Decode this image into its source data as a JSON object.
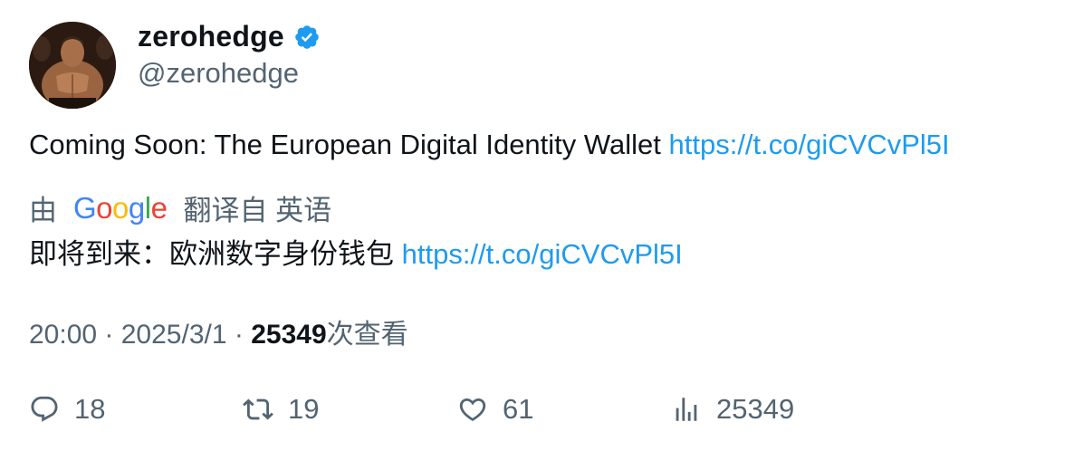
{
  "author": {
    "display_name": "zerohedge",
    "handle": "@zerohedge",
    "verified_icon": "verified-badge-icon",
    "verified_color": "#1d9bf0"
  },
  "tweet": {
    "text": "Coming Soon: The European Digital Identity Wallet ",
    "link": "https://t.co/giCVCvPl5I"
  },
  "translation": {
    "prefix": "由",
    "provider": "Google",
    "suffix": "翻译自 英语",
    "text": "即将到来：欧洲数字身份钱包 ",
    "link": "https://t.co/giCVCvPl5I"
  },
  "meta": {
    "time": "20:00",
    "separator1": " · ",
    "date": "2025/3/1",
    "separator2": " · ",
    "views": "25349",
    "views_label": "次查看"
  },
  "actions": {
    "replies": "18",
    "retweets": "19",
    "likes": "61",
    "views": "25349"
  },
  "colors": {
    "text": "#0f1419",
    "secondary": "#536471",
    "link": "#1d9bf0"
  }
}
